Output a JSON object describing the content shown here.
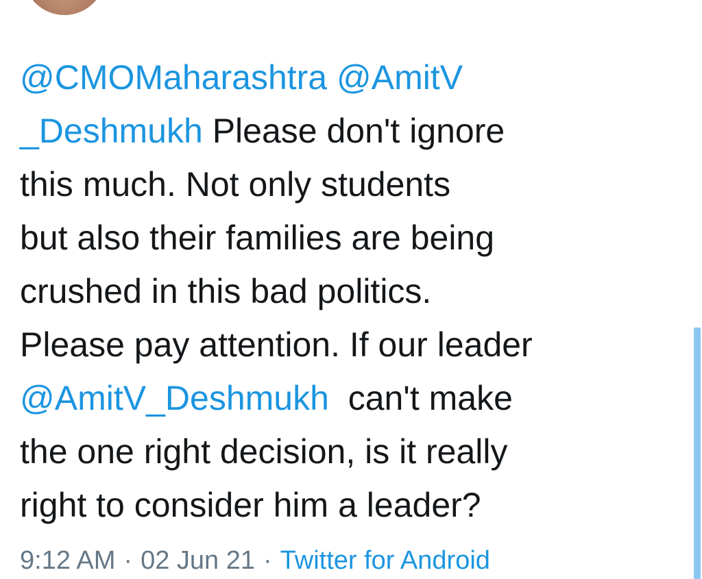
{
  "app": "Twitter",
  "tweet": {
    "lines": [
      [
        {
          "type": "mention",
          "text": "@CMOMaharashtra"
        },
        {
          "type": "text",
          "text": " "
        },
        {
          "type": "mention",
          "text": "@AmitV"
        }
      ],
      [
        {
          "type": "mention",
          "text": "_Deshmukh"
        },
        {
          "type": "text",
          "text": " Please don't ignore"
        }
      ],
      [
        {
          "type": "text",
          "text": "this much. Not only students"
        }
      ],
      [
        {
          "type": "text",
          "text": "but also their families are being"
        }
      ],
      [
        {
          "type": "text",
          "text": "crushed in this bad politics."
        }
      ],
      [
        {
          "type": "text",
          "text": "Please pay attention. If our leader"
        }
      ],
      [
        {
          "type": "mention",
          "text": "@AmitV_Deshmukh"
        },
        {
          "type": "text",
          "text": "  can't make"
        }
      ],
      [
        {
          "type": "text",
          "text": "the one right decision, is it really"
        }
      ],
      [
        {
          "type": "text",
          "text": "right to consider him a leader?"
        }
      ]
    ]
  },
  "meta": {
    "time": "9:12 AM",
    "separator": "·",
    "date": "02 Jun 21",
    "source": "Twitter for Android"
  },
  "colors": {
    "mention": "#1b95e0",
    "text": "#14171a",
    "meta": "#657786",
    "scrollbar": "#8cc7f1"
  }
}
